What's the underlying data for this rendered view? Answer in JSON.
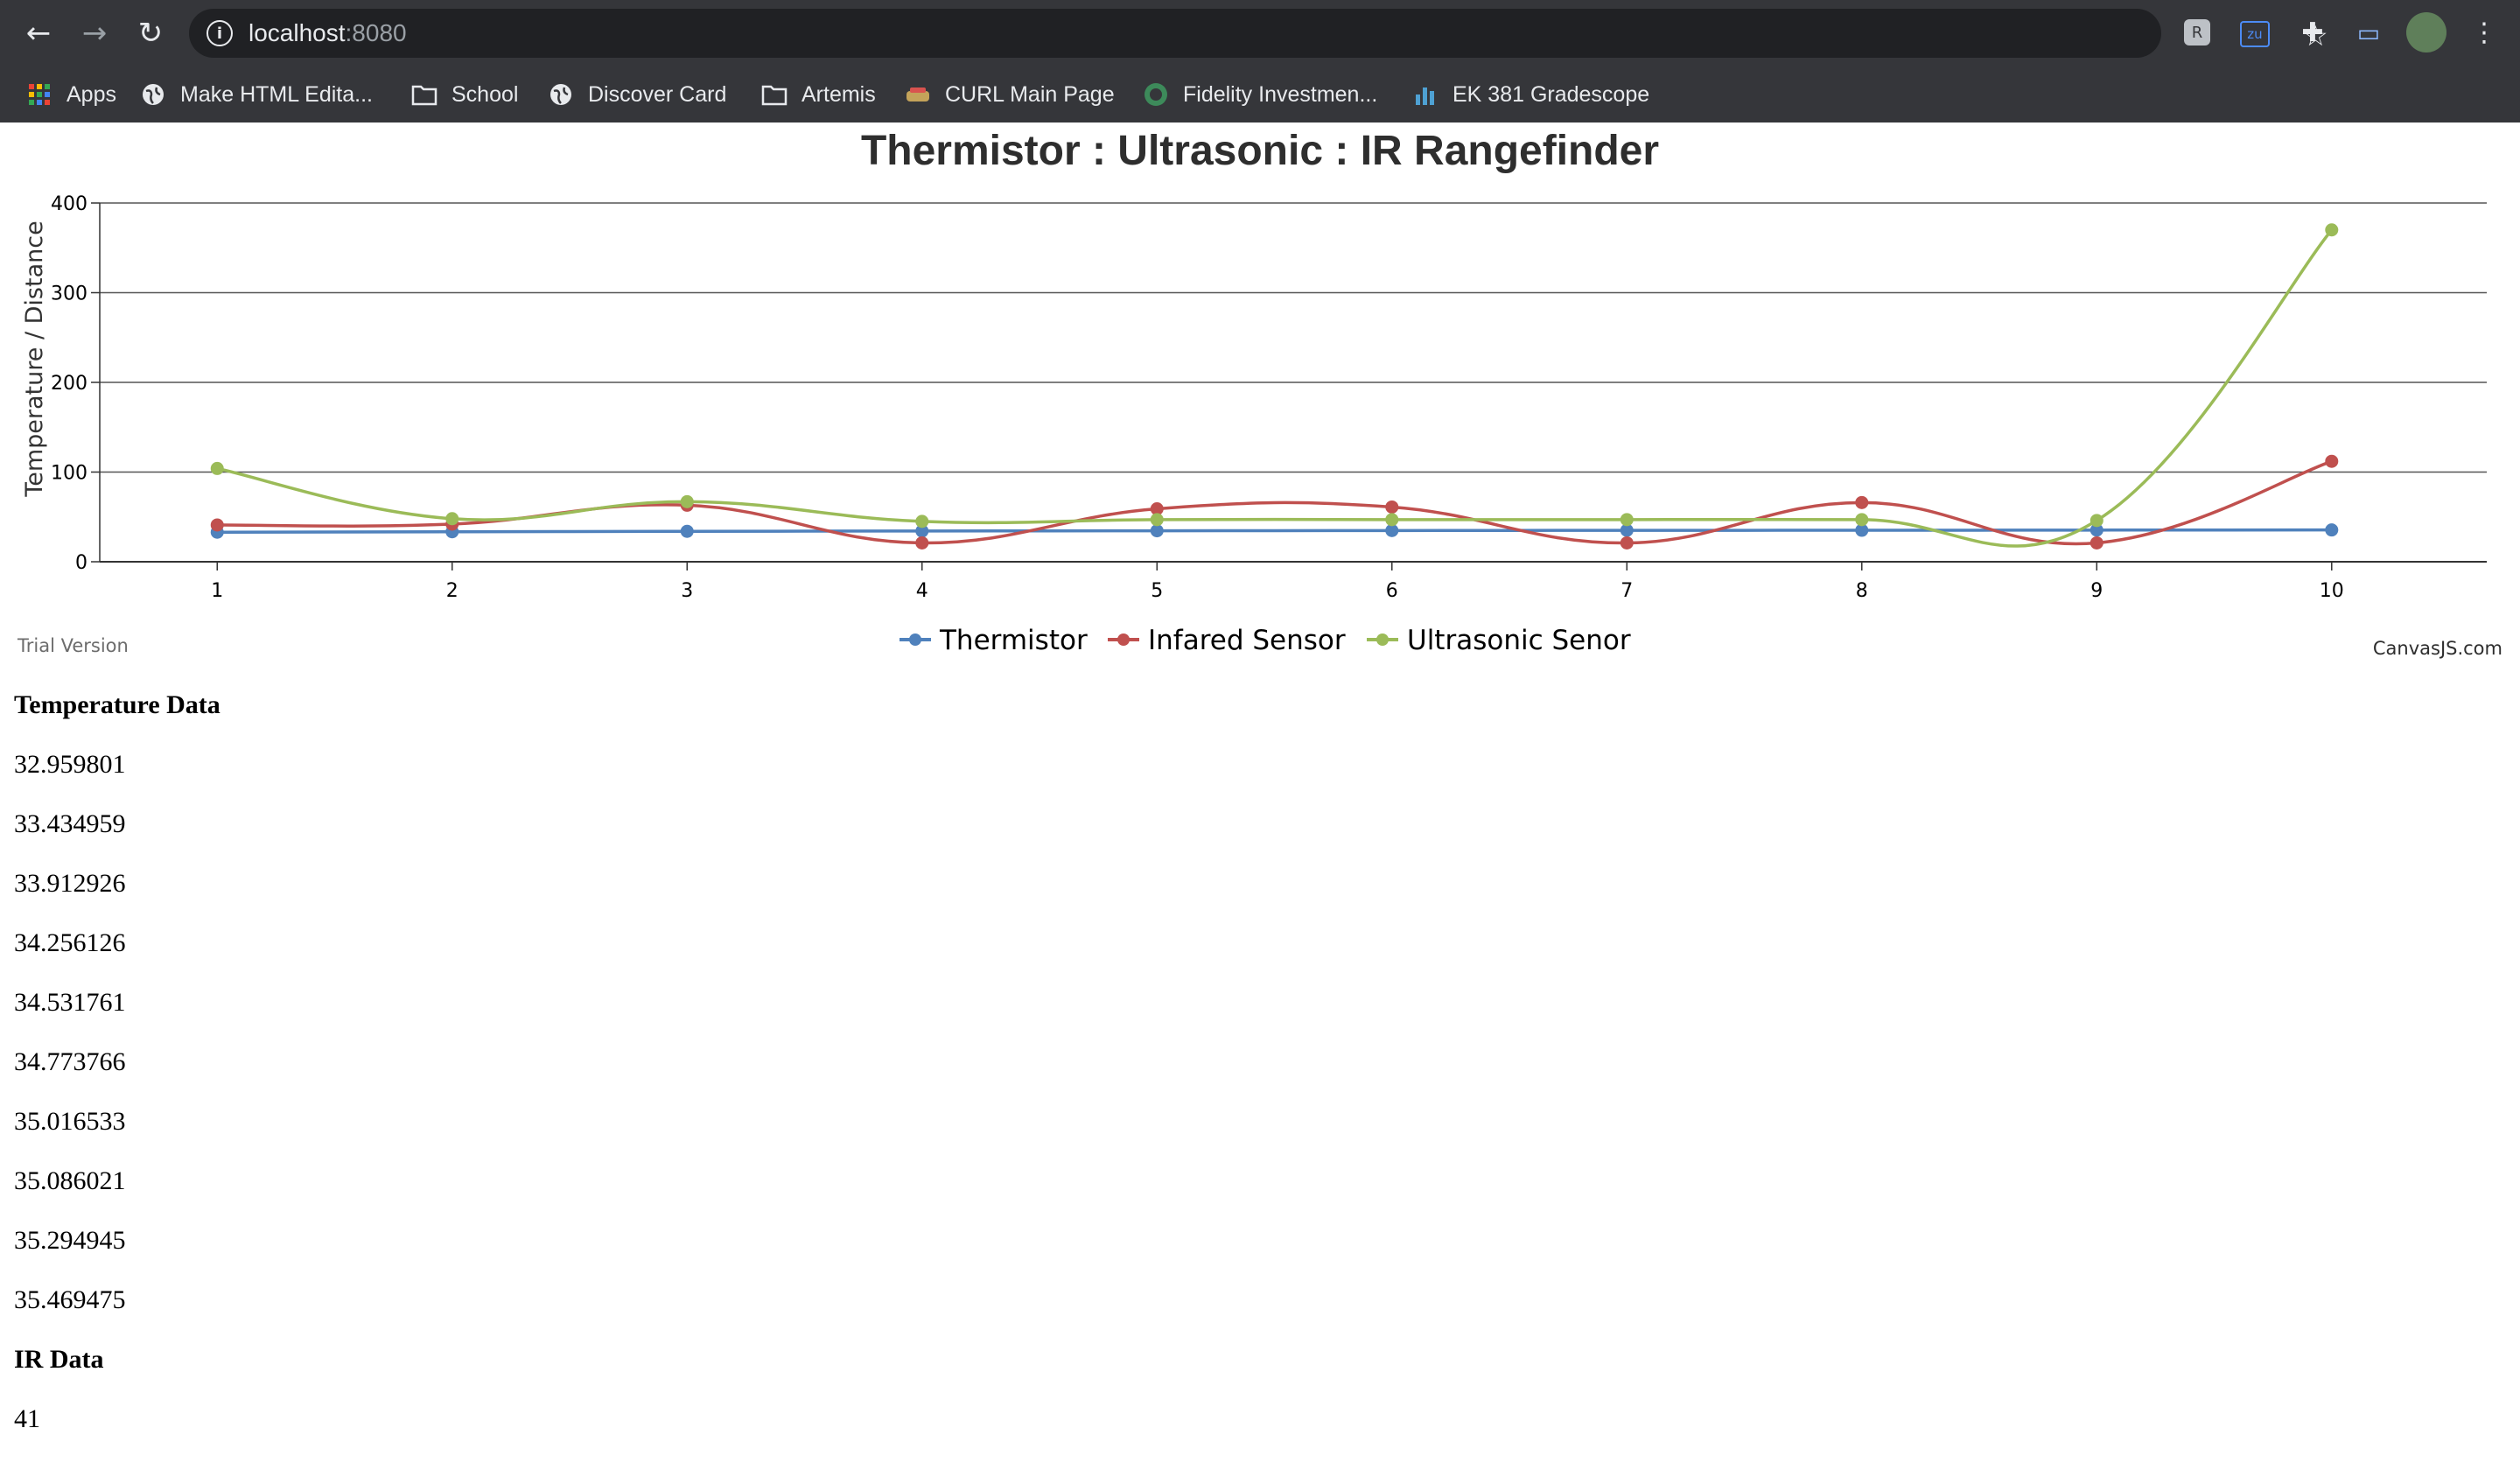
{
  "browser": {
    "url_host": "localhost",
    "url_port": ":8080",
    "bookmarks": [
      {
        "label": "Apps",
        "icon": "apps-grid-icon"
      },
      {
        "label": "Make HTML Edita...",
        "icon": "globe-icon"
      },
      {
        "label": "School",
        "icon": "folder-icon"
      },
      {
        "label": "Discover Card",
        "icon": "globe-icon"
      },
      {
        "label": "Artemis",
        "icon": "folder-icon"
      },
      {
        "label": "CURL Main Page",
        "icon": "curl-icon"
      },
      {
        "label": "Fidelity Investmen...",
        "icon": "fidelity-icon"
      },
      {
        "label": "EK 381 Gradescope",
        "icon": "gradescope-icon"
      }
    ]
  },
  "chart_data": {
    "type": "line",
    "title": "Thermistor : Ultrasonic : IR Rangefinder",
    "ylabel": "Temperature / Distance",
    "xlabel": "",
    "x": [
      1,
      2,
      3,
      4,
      5,
      6,
      7,
      8,
      9,
      10
    ],
    "ylim": [
      0,
      400
    ],
    "yticks": [
      0,
      100,
      200,
      300,
      400
    ],
    "grid": true,
    "legend_position": "bottom",
    "series": [
      {
        "name": "Thermistor",
        "color": "#4f81bc",
        "values": [
          32.959801,
          33.434959,
          33.912926,
          34.256126,
          34.531761,
          34.773766,
          35.016533,
          35.086021,
          35.294945,
          35.469475
        ]
      },
      {
        "name": "Infared Sensor",
        "color": "#c0504e",
        "values": [
          41,
          42,
          63,
          21,
          59,
          61,
          21,
          66,
          21,
          112
        ]
      },
      {
        "name": "Ultrasonic Senor",
        "color": "#9bbb58",
        "values": [
          104,
          48,
          67,
          45,
          47,
          47,
          47,
          47,
          46,
          370
        ]
      }
    ],
    "watermark_left": "Trial Version",
    "watermark_right": "CanvasJS.com"
  },
  "content": {
    "temperature_heading": "Temperature Data",
    "temperature_values": [
      "32.959801",
      "33.434959",
      "33.912926",
      "34.256126",
      "34.531761",
      "34.773766",
      "35.016533",
      "35.086021",
      "35.294945",
      "35.469475"
    ],
    "ir_heading": "IR Data",
    "ir_values": [
      "41"
    ]
  }
}
